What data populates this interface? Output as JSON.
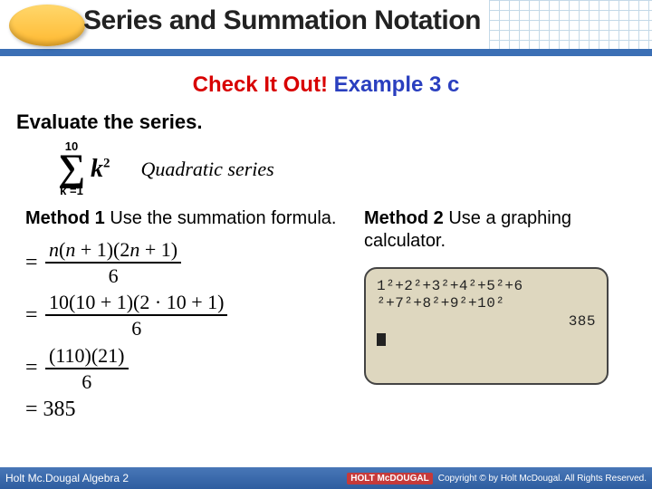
{
  "header": {
    "title": "Series and Summation Notation"
  },
  "subtitle": {
    "red": "Check It Out!",
    "blue": "Example 3 c"
  },
  "prompt": "Evaluate the series.",
  "sigma": {
    "upper": "10",
    "symbol": "∑",
    "lower": "k =1",
    "term_k": "k",
    "term_exp": "2"
  },
  "series_type": "Quadratic series",
  "method1": {
    "bold": "Method 1",
    "rest": " Use the summation formula."
  },
  "method2": {
    "bold": "Method 2",
    "rest": " Use a graphing calculator."
  },
  "eq1": {
    "num": "n(n + 1)(2n + 1)",
    "den": "6"
  },
  "eq2": {
    "num": "10(10 + 1)(2 · 10 + 1)",
    "den": "6"
  },
  "eq3": {
    "num": "(110)(21)",
    "den": "6"
  },
  "final": "= 385",
  "calc": {
    "line1": "1²+2²+3²+4²+5²+6",
    "line2": "²+7²+8²+9²+10²",
    "result": "385"
  },
  "footer": {
    "book": "Holt Mc.Dougal Algebra 2",
    "badge": "HOLT McDOUGAL",
    "copy": "Copyright © by Holt McDougal. All Rights Reserved."
  }
}
